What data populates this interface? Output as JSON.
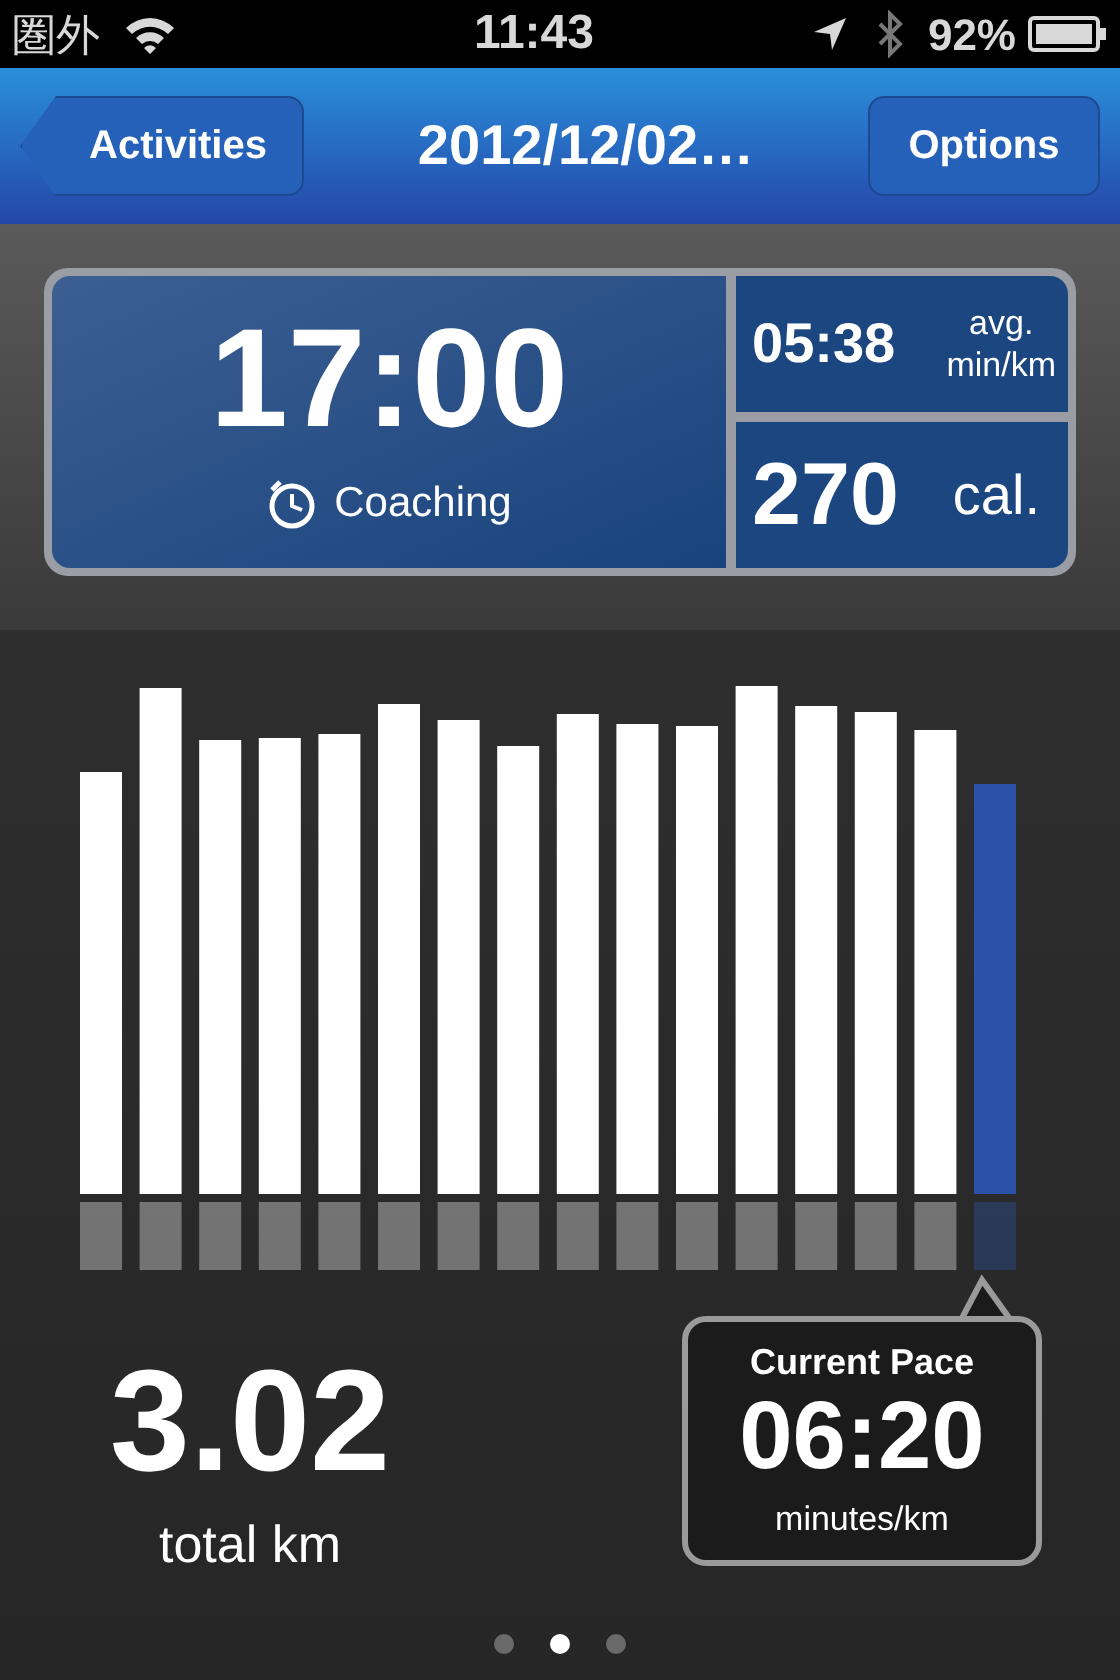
{
  "status_bar": {
    "carrier": "圏外",
    "time": "11:43",
    "battery": "92%"
  },
  "nav": {
    "back": "Activities",
    "title": "2012/12/02…",
    "action": "Options"
  },
  "summary": {
    "duration": "17:00",
    "mode": "Coaching",
    "avg_pace": "05:38",
    "avg_unit_1": "avg.",
    "avg_unit_2": "min/km",
    "calories": "270",
    "calories_unit": "cal."
  },
  "distance": {
    "value": "3.02",
    "unit": "total km"
  },
  "current_pace": {
    "label": "Current Pace",
    "value": "06:20",
    "unit": "minutes/km"
  },
  "page_dots": [
    {
      "selected": false
    },
    {
      "selected": true
    },
    {
      "selected": false
    }
  ]
}
